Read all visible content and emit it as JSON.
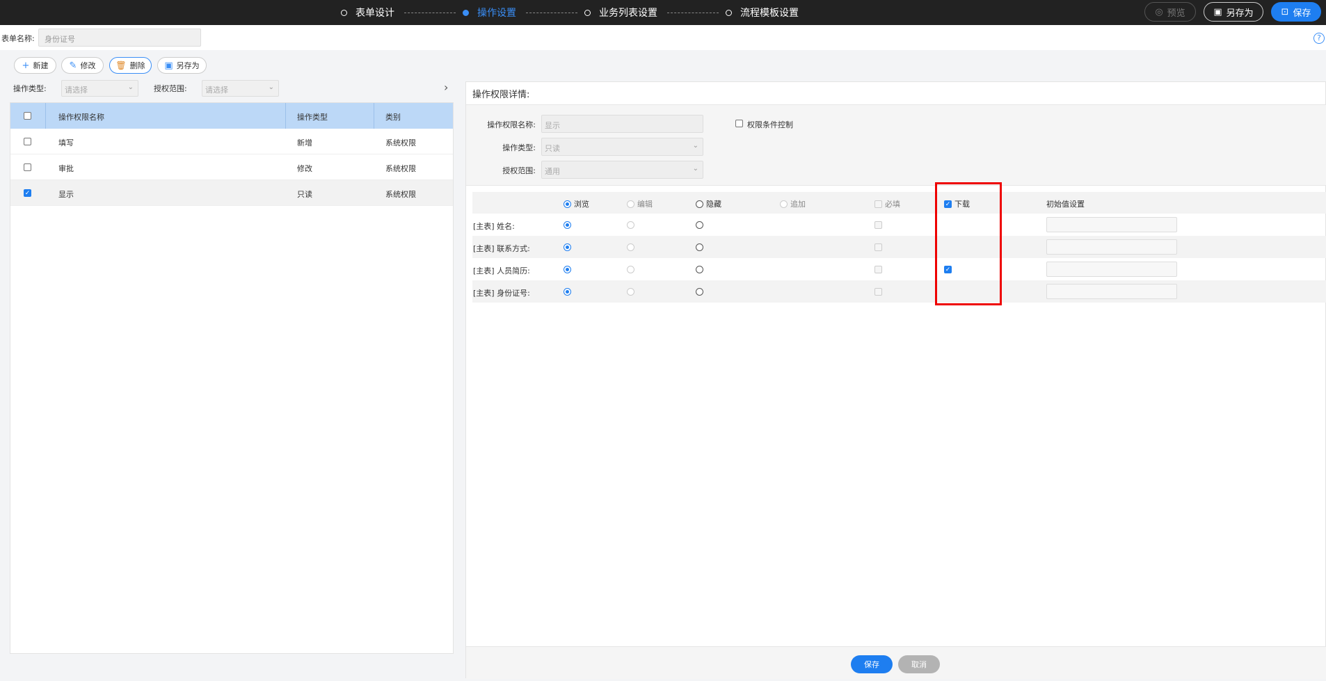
{
  "steps": [
    {
      "label": "表单设计",
      "active": false
    },
    {
      "label": "操作设置",
      "active": true
    },
    {
      "label": "业务列表设置",
      "active": false
    },
    {
      "label": "流程模板设置",
      "active": false
    }
  ],
  "header": {
    "preview_label": "预览",
    "saveas_label": "另存为",
    "save_label": "保存"
  },
  "form": {
    "name_label": "表单名称:",
    "name_value": "身份证号",
    "help_glyph": "?"
  },
  "toolbar": {
    "new_label": "新建",
    "edit_label": "修改",
    "delete_label": "删除",
    "saveas_label": "另存为"
  },
  "filters": {
    "op_type_label": "操作类型:",
    "scope_label": "授权范围:",
    "placeholder": "请选择"
  },
  "table": {
    "columns": [
      "操作权限名称",
      "操作类型",
      "类别"
    ],
    "rows": [
      {
        "name": "填写",
        "type": "新增",
        "category": "系统权限",
        "checked": false
      },
      {
        "name": "审批",
        "type": "修改",
        "category": "系统权限",
        "checked": false
      },
      {
        "name": "显示",
        "type": "只读",
        "category": "系统权限",
        "checked": true
      }
    ]
  },
  "detail": {
    "title": "操作权限详情:",
    "perm_name_label": "操作权限名称:",
    "perm_name_value": "显示",
    "condition_label": "权限条件控制",
    "op_type_label": "操作类型:",
    "op_type_value": "只读",
    "scope_label": "授权范围:",
    "scope_value": "通用"
  },
  "grid": {
    "headers": {
      "browse": "浏览",
      "edit": "编辑",
      "hide": "隐藏",
      "append": "追加",
      "required": "必填",
      "download": "下载",
      "initial": "初始值设置"
    },
    "download_header_checked": true,
    "fields": [
      {
        "label": "[主表] 姓名:",
        "browse": true,
        "download": false
      },
      {
        "label": "[主表] 联系方式:",
        "browse": true,
        "download": false
      },
      {
        "label": "[主表] 人员简历:",
        "browse": true,
        "download": true
      },
      {
        "label": "[主表] 身份证号:",
        "browse": true,
        "download": false
      }
    ]
  },
  "footer": {
    "save_label": "保存",
    "cancel_label": "取消"
  },
  "colors": {
    "accent": "#1e7ef0",
    "highlight": "#e00000",
    "header_bg": "#222222",
    "table_header": "#bcd8f7"
  }
}
